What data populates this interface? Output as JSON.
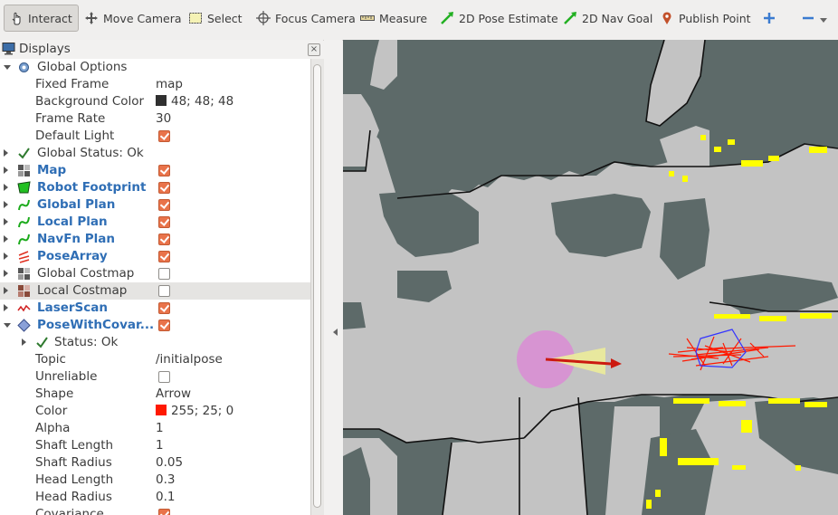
{
  "toolbar": {
    "tools": [
      {
        "label": "Interact",
        "icon": "hand-pointer-icon"
      },
      {
        "label": "Move Camera",
        "icon": "move-camera-icon"
      },
      {
        "label": "Select",
        "icon": "select-icon"
      },
      {
        "label": "Focus Camera",
        "icon": "focus-camera-icon"
      },
      {
        "label": "Measure",
        "icon": "ruler-icon"
      },
      {
        "label": "2D Pose Estimate",
        "icon": "green-arrow-icon"
      },
      {
        "label": "2D Nav Goal",
        "icon": "green-arrow-icon"
      },
      {
        "label": "Publish Point",
        "icon": "map-pin-icon"
      }
    ],
    "add_icon": "plus-icon",
    "remove_icon": "minus-icon"
  },
  "displays_panel": {
    "title": "Displays",
    "close_symbol": "×",
    "rows": [
      {
        "label": "Global Options",
        "value": "",
        "icon": "gear-icon",
        "expander": "down",
        "indent": 0
      },
      {
        "label": "Fixed Frame",
        "value": "map",
        "indent": 1
      },
      {
        "label": "Background Color",
        "value": "48; 48; 48",
        "swatch": "#303030",
        "indent": 1
      },
      {
        "label": "Frame Rate",
        "value": "30",
        "indent": 1
      },
      {
        "label": "Default Light",
        "checkbox": true,
        "indent": 1
      },
      {
        "label": "Global Status: Ok",
        "icon": "check-icon",
        "expander": "right",
        "indent": 0
      },
      {
        "label": "Map",
        "icon": "grid-map-icon",
        "expander": "right",
        "checkbox": true,
        "blue": true,
        "indent": 0
      },
      {
        "label": "Robot Footprint",
        "icon": "footprint-icon",
        "expander": "right",
        "checkbox": true,
        "blue": true,
        "indent": 0
      },
      {
        "label": "Global Plan",
        "icon": "path-icon",
        "expander": "right",
        "checkbox": true,
        "blue": true,
        "indent": 0
      },
      {
        "label": "Local Plan",
        "icon": "path-icon",
        "expander": "right",
        "checkbox": true,
        "blue": true,
        "indent": 0
      },
      {
        "label": "NavFn Plan",
        "icon": "path-icon",
        "expander": "right",
        "checkbox": true,
        "blue": true,
        "indent": 0
      },
      {
        "label": "PoseArray",
        "icon": "pose-array-icon",
        "expander": "right",
        "checkbox": true,
        "blue": true,
        "indent": 0
      },
      {
        "label": "Global Costmap",
        "icon": "grid-map-icon",
        "expander": "right",
        "checkbox": false,
        "indent": 0
      },
      {
        "label": "Local Costmap",
        "icon": "costmap-icon",
        "expander": "right",
        "checkbox": false,
        "indent": 0,
        "selected": true
      },
      {
        "label": "LaserScan",
        "icon": "laser-scan-icon",
        "expander": "right",
        "checkbox": true,
        "blue": true,
        "indent": 0
      },
      {
        "label": "PoseWithCovar...",
        "icon": "pose-covariance-icon",
        "expander": "down",
        "checkbox": true,
        "blue": true,
        "indent": 0
      },
      {
        "label": "Status: Ok",
        "icon": "check-icon",
        "expander": "right",
        "indent": 1
      },
      {
        "label": "Topic",
        "value": "/initialpose",
        "indent": 1
      },
      {
        "label": "Unreliable",
        "checkbox": false,
        "indent": 1
      },
      {
        "label": "Shape",
        "value": "Arrow",
        "indent": 1
      },
      {
        "label": "Color",
        "value": "255; 25; 0",
        "swatch": "#ff1900",
        "indent": 1
      },
      {
        "label": "Alpha",
        "value": "1",
        "indent": 1
      },
      {
        "label": "Shaft Length",
        "value": "1",
        "indent": 1
      },
      {
        "label": "Shaft Radius",
        "value": "0.05",
        "indent": 1
      },
      {
        "label": "Head Length",
        "value": "0.3",
        "indent": 1
      },
      {
        "label": "Head Radius",
        "value": "0.1",
        "indent": 1
      },
      {
        "label": "Covariance",
        "checkbox": true,
        "indent": 1
      }
    ]
  },
  "colors": {
    "map_unknown": "#5d6a69",
    "map_free": "#c3c3c3",
    "map_obstacle": "#000000",
    "costmap_marker": "#ffff00",
    "robot_footprint": "#d98fd4",
    "laser_particles": "#ff1900",
    "pose_arrow": "#cc1a10",
    "covariance_cone": "#ecec9a",
    "footprint_outline": "#3333ff"
  }
}
